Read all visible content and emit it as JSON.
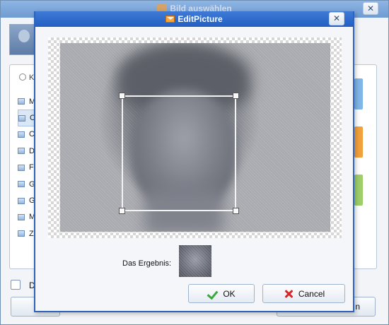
{
  "background_window": {
    "title": "Bild auswählen",
    "close_glyph": "✕",
    "list_header": "K",
    "list_items": [
      "M",
      "C",
      "C",
      "D",
      "F",
      "G",
      "G",
      "M",
      "Z"
    ],
    "checkbox_label": "D",
    "button_label": "n"
  },
  "dialog": {
    "title": "EditPicture",
    "close_glyph": "✕",
    "result_label": "Das Ergebnis:",
    "ok_label": "OK",
    "cancel_label": "Cancel",
    "ok_icon": "green-check-icon",
    "cancel_icon": "red-x-icon"
  },
  "colors": {
    "dialog_titlebar": "#235fc2",
    "ok_icon": "#3aa83a",
    "cancel_icon": "#d62626"
  }
}
